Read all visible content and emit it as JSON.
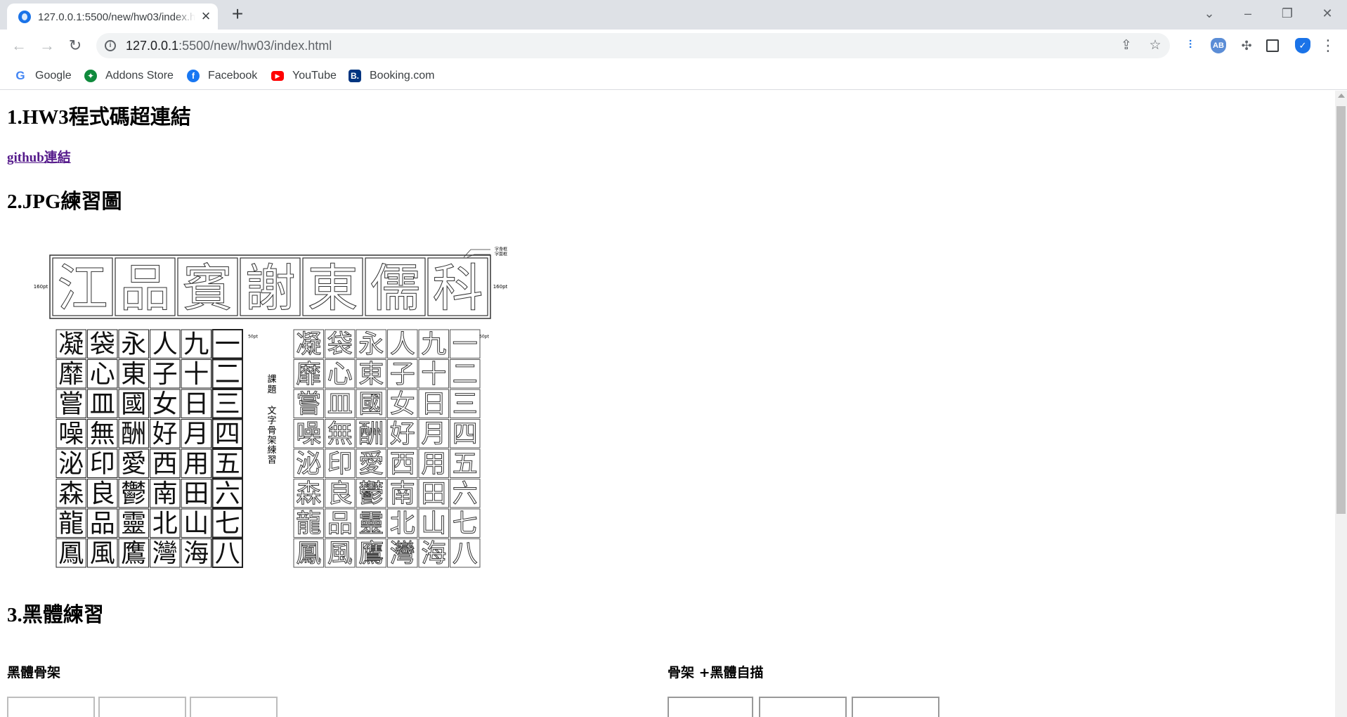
{
  "browser": {
    "tab_title": "127.0.0.1:5500/new/hw03/index.html",
    "url_host": "127.0.0.1",
    "url_path": ":5500/new/hw03/index.html",
    "bookmarks": [
      {
        "label": "Google",
        "icon": "google-icon"
      },
      {
        "label": "Addons Store",
        "icon": "addons-store-icon"
      },
      {
        "label": "Facebook",
        "icon": "facebook-icon"
      },
      {
        "label": "YouTube",
        "icon": "youtube-icon"
      },
      {
        "label": "Booking.com",
        "icon": "booking-icon"
      }
    ],
    "extensions": [
      "extension-1-icon",
      "adblock-icon",
      "puzzle-icon",
      "side-panel-icon",
      "shield-icon"
    ]
  },
  "page": {
    "section1_heading": "1.HW3程式碼超連結",
    "github_link": "github連結",
    "section2_heading": "2.JPG練習圖",
    "section3_heading": "3.黑體練習",
    "sub_left": "黑體骨架",
    "sub_right": "骨架 +黑體自描"
  },
  "practice_sheet": {
    "top_row": [
      "江",
      "品",
      "賓",
      "謝",
      "東",
      "儒",
      "科"
    ],
    "top_size_label_left": "160pt",
    "top_size_label_right": "160pt",
    "legend_lines": [
      "字身框",
      "字面框"
    ],
    "grid_size_label": "50pt",
    "grid_rows": [
      [
        "凝",
        "袋",
        "永",
        "人",
        "九",
        "一"
      ],
      [
        "靡",
        "心",
        "東",
        "子",
        "十",
        "二"
      ],
      [
        "嘗",
        "皿",
        "國",
        "女",
        "日",
        "三"
      ],
      [
        "噪",
        "無",
        "酬",
        "好",
        "月",
        "四"
      ],
      [
        "泌",
        "印",
        "愛",
        "西",
        "用",
        "五"
      ],
      [
        "森",
        "良",
        "鬱",
        "南",
        "田",
        "六"
      ],
      [
        "龍",
        "品",
        "靈",
        "北",
        "山",
        "七"
      ],
      [
        "鳳",
        "風",
        "鷹",
        "灣",
        "海",
        "八"
      ]
    ],
    "title_vertical_1": "課題",
    "title_vertical_2": "文字骨架練習"
  }
}
